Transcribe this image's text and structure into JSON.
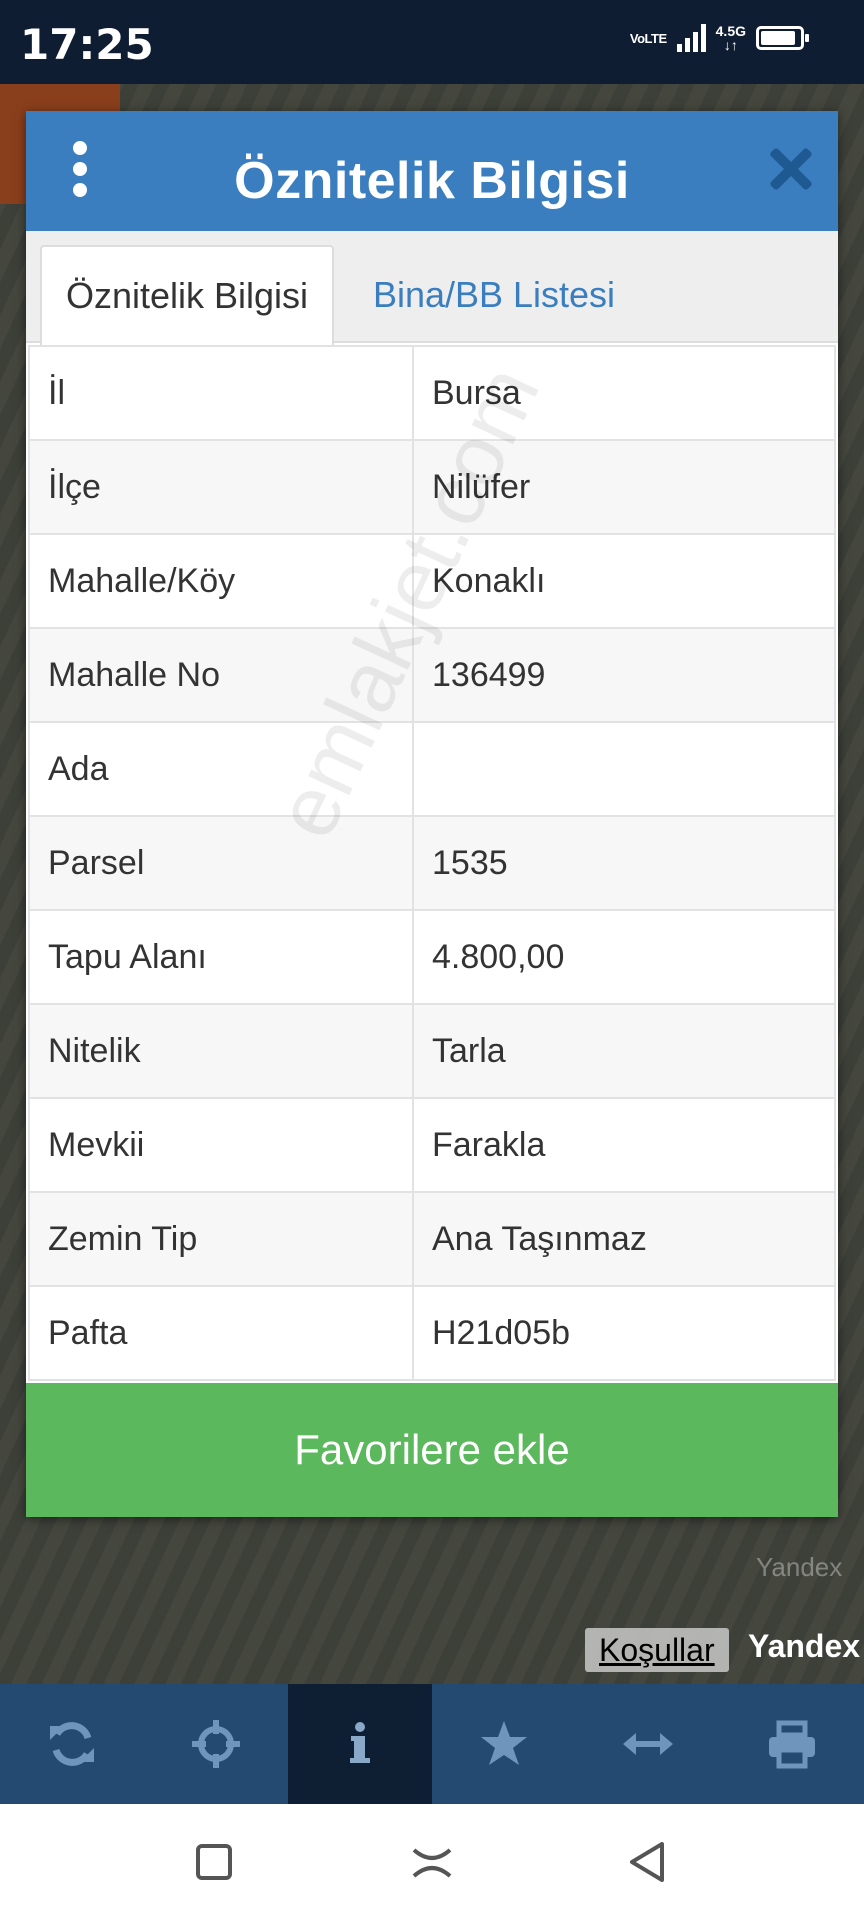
{
  "status_bar": {
    "time": "17:25",
    "volte": "VoLTE",
    "network": "4.5G"
  },
  "modal": {
    "title": "Öznitelik Bilgisi",
    "tabs": [
      {
        "label": "Öznitelik Bilgisi",
        "active": true
      },
      {
        "label": "Bina/BB Listesi",
        "active": false
      }
    ],
    "rows": [
      {
        "key": "İl",
        "value": "Bursa"
      },
      {
        "key": "İlçe",
        "value": "Nilüfer"
      },
      {
        "key": "Mahalle/Köy",
        "value": "Konaklı"
      },
      {
        "key": "Mahalle No",
        "value": "136499"
      },
      {
        "key": "Ada",
        "value": ""
      },
      {
        "key": "Parsel",
        "value": "1535"
      },
      {
        "key": "Tapu Alanı",
        "value": "4.800,00"
      },
      {
        "key": "Nitelik",
        "value": "Tarla"
      },
      {
        "key": "Mevkii",
        "value": "Farakla"
      },
      {
        "key": "Zemin Tip",
        "value": "Ana Taşınmaz"
      },
      {
        "key": "Pafta",
        "value": "H21d05b"
      }
    ],
    "favorite_label": "Favorilere ekle",
    "watermark": "emlakjet.com"
  },
  "map": {
    "terms_label": "Koşullar",
    "provider": "Yandex",
    "provider_small": "Yandex"
  },
  "toolbar": {
    "items": [
      {
        "icon": "refresh-icon",
        "active": false
      },
      {
        "icon": "crosshair-icon",
        "active": false
      },
      {
        "icon": "info-icon",
        "active": true
      },
      {
        "icon": "star-icon",
        "active": false
      },
      {
        "icon": "measure-arrows-icon",
        "active": false
      },
      {
        "icon": "print-icon",
        "active": false
      }
    ]
  },
  "colors": {
    "header": "#3a7ebf",
    "favorite": "#5cb85c",
    "toolbar": "#244a72",
    "toolbar_active": "#0e1e33"
  }
}
